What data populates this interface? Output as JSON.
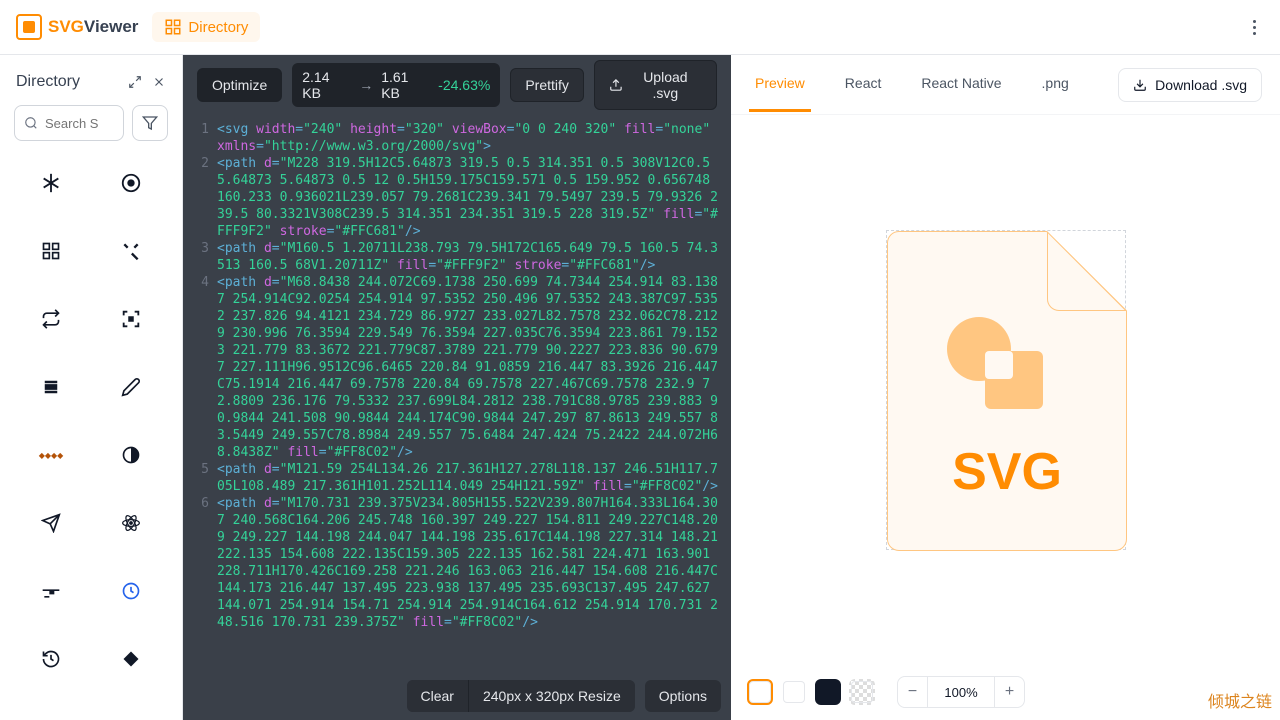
{
  "header": {
    "logo_svg": "SVG",
    "logo_viewer": "Viewer",
    "directory_label": "Directory"
  },
  "sidebar": {
    "title": "Directory",
    "search_placeholder": "Search S"
  },
  "editor": {
    "optimize_label": "Optimize",
    "size_before": "2.14 KB",
    "size_after": "1.61 KB",
    "size_pct": "-24.63%",
    "prettify_label": "Prettify",
    "upload_label": "Upload .svg",
    "clear_label": "Clear",
    "resize_label": "240px x 320px  Resize",
    "options_label": "Options",
    "code_lines": [
      {
        "n": "1",
        "html": "<span class='t-punc'>&lt;</span><span class='t-tag'>svg</span> <span class='t-attr'>width</span><span class='t-eq'>=</span><span class='t-str'>\"240\"</span> <span class='t-attr'>height</span><span class='t-eq'>=</span><span class='t-str'>\"320\"</span> <span class='t-attr'>viewBox</span><span class='t-eq'>=</span><span class='t-str'>\"0 0 240 320\"</span> <span class='t-attr'>fill</span><span class='t-eq'>=</span><span class='t-str'>\"none\"</span> <span class='t-attr'>xmlns</span><span class='t-eq'>=</span><span class='t-str'>\"http://www.w3.org/2000/svg\"</span><span class='t-punc'>&gt;</span>"
      },
      {
        "n": "2",
        "html": "<span class='t-punc'>&lt;</span><span class='t-tag'>path</span> <span class='t-attr'>d</span><span class='t-eq'>=</span><span class='t-str'>\"M228 319.5H12C5.64873 319.5 0.5 314.351 0.5 308V12C0.5 5.64873 5.64873 0.5 12 0.5H159.175C159.571 0.5 159.952 0.656748 160.233 0.936021L239.057 79.2681C239.341 79.5497 239.5 79.9326 239.5 80.3321V308C239.5 314.351 234.351 319.5 228 319.5Z\"</span> <span class='t-attr'>fill</span><span class='t-eq'>=</span><span class='t-str'>\"#FFF9F2\"</span> <span class='t-attr'>stroke</span><span class='t-eq'>=</span><span class='t-str'>\"#FFC681\"</span><span class='t-punc'>/&gt;</span>"
      },
      {
        "n": "3",
        "html": "<span class='t-punc'>&lt;</span><span class='t-tag'>path</span> <span class='t-attr'>d</span><span class='t-eq'>=</span><span class='t-str'>\"M160.5 1.20711L238.793 79.5H172C165.649 79.5 160.5 74.3513 160.5 68V1.20711Z\"</span> <span class='t-attr'>fill</span><span class='t-eq'>=</span><span class='t-str'>\"#FFF9F2\"</span> <span class='t-attr'>stroke</span><span class='t-eq'>=</span><span class='t-str'>\"#FFC681\"</span><span class='t-punc'>/&gt;</span>"
      },
      {
        "n": "4",
        "html": "<span class='t-punc'>&lt;</span><span class='t-tag'>path</span> <span class='t-attr'>d</span><span class='t-eq'>=</span><span class='t-str'>\"M68.8438 244.072C69.1738 250.699 74.7344 254.914 83.1387 254.914C92.0254 254.914 97.5352 250.496 97.5352 243.387C97.5352 237.826 94.4121 234.729 86.9727 233.027L82.7578 232.062C78.2129 230.996 76.3594 229.549 76.3594 227.035C76.3594 223.861 79.1523 221.779 83.3672 221.779C87.3789 221.779 90.2227 223.836 90.6797 227.111H96.9512C96.6465 220.84 91.0859 216.447 83.3926 216.447C75.1914 216.447 69.7578 220.84 69.7578 227.467C69.7578 232.9 72.8809 236.176 79.5332 237.699L84.2812 238.791C88.9785 239.883 90.9844 241.508 90.9844 244.174C90.9844 247.297 87.8613 249.557 83.5449 249.557C78.8984 249.557 75.6484 247.424 75.2422 244.072H68.8438Z\"</span> <span class='t-attr'>fill</span><span class='t-eq'>=</span><span class='t-str'>\"#FF8C02\"</span><span class='t-punc'>/&gt;</span>"
      },
      {
        "n": "5",
        "html": "<span class='t-punc'>&lt;</span><span class='t-tag'>path</span> <span class='t-attr'>d</span><span class='t-eq'>=</span><span class='t-str'>\"M121.59 254L134.26 217.361H127.278L118.137 246.51H117.705L108.489 217.361H101.252L114.049 254H121.59Z\"</span> <span class='t-attr'>fill</span><span class='t-eq'>=</span><span class='t-str'>\"#FF8C02\"</span><span class='t-punc'>/&gt;</span>"
      },
      {
        "n": "6",
        "html": "<span class='t-punc'>&lt;</span><span class='t-tag'>path</span> <span class='t-attr'>d</span><span class='t-eq'>=</span><span class='t-str'>\"M170.731 239.375V234.805H155.522V239.807H164.333L164.307 240.568C164.206 245.748 160.397 249.227 154.811 249.227C148.209 249.227 144.198 244.047 144.198 235.617C144.198 227.314 148.21 222.135 154.608 222.135C159.305 222.135 162.581 224.471 163.901 228.711H170.426C169.258 221.246 163.063 216.447 154.608 216.447C144.173 216.447 137.495 223.938 137.495 235.693C137.495 247.627 144.071 254.914 154.71 254.914 254.914C164.612 254.914 170.731 248.516 170.731 239.375Z\"</span> <span class='t-attr'>fill</span><span class='t-eq'>=</span><span class='t-str'>\"#FF8C02\"</span><span class='t-punc'>/&gt;</span>"
      }
    ]
  },
  "preview": {
    "tabs": [
      "Preview",
      "React",
      "React Native",
      ".png"
    ],
    "active_tab": 0,
    "download_label": "Download .svg",
    "svg_label": "SVG",
    "zoom": "100%"
  },
  "watermark": "倾城之链"
}
